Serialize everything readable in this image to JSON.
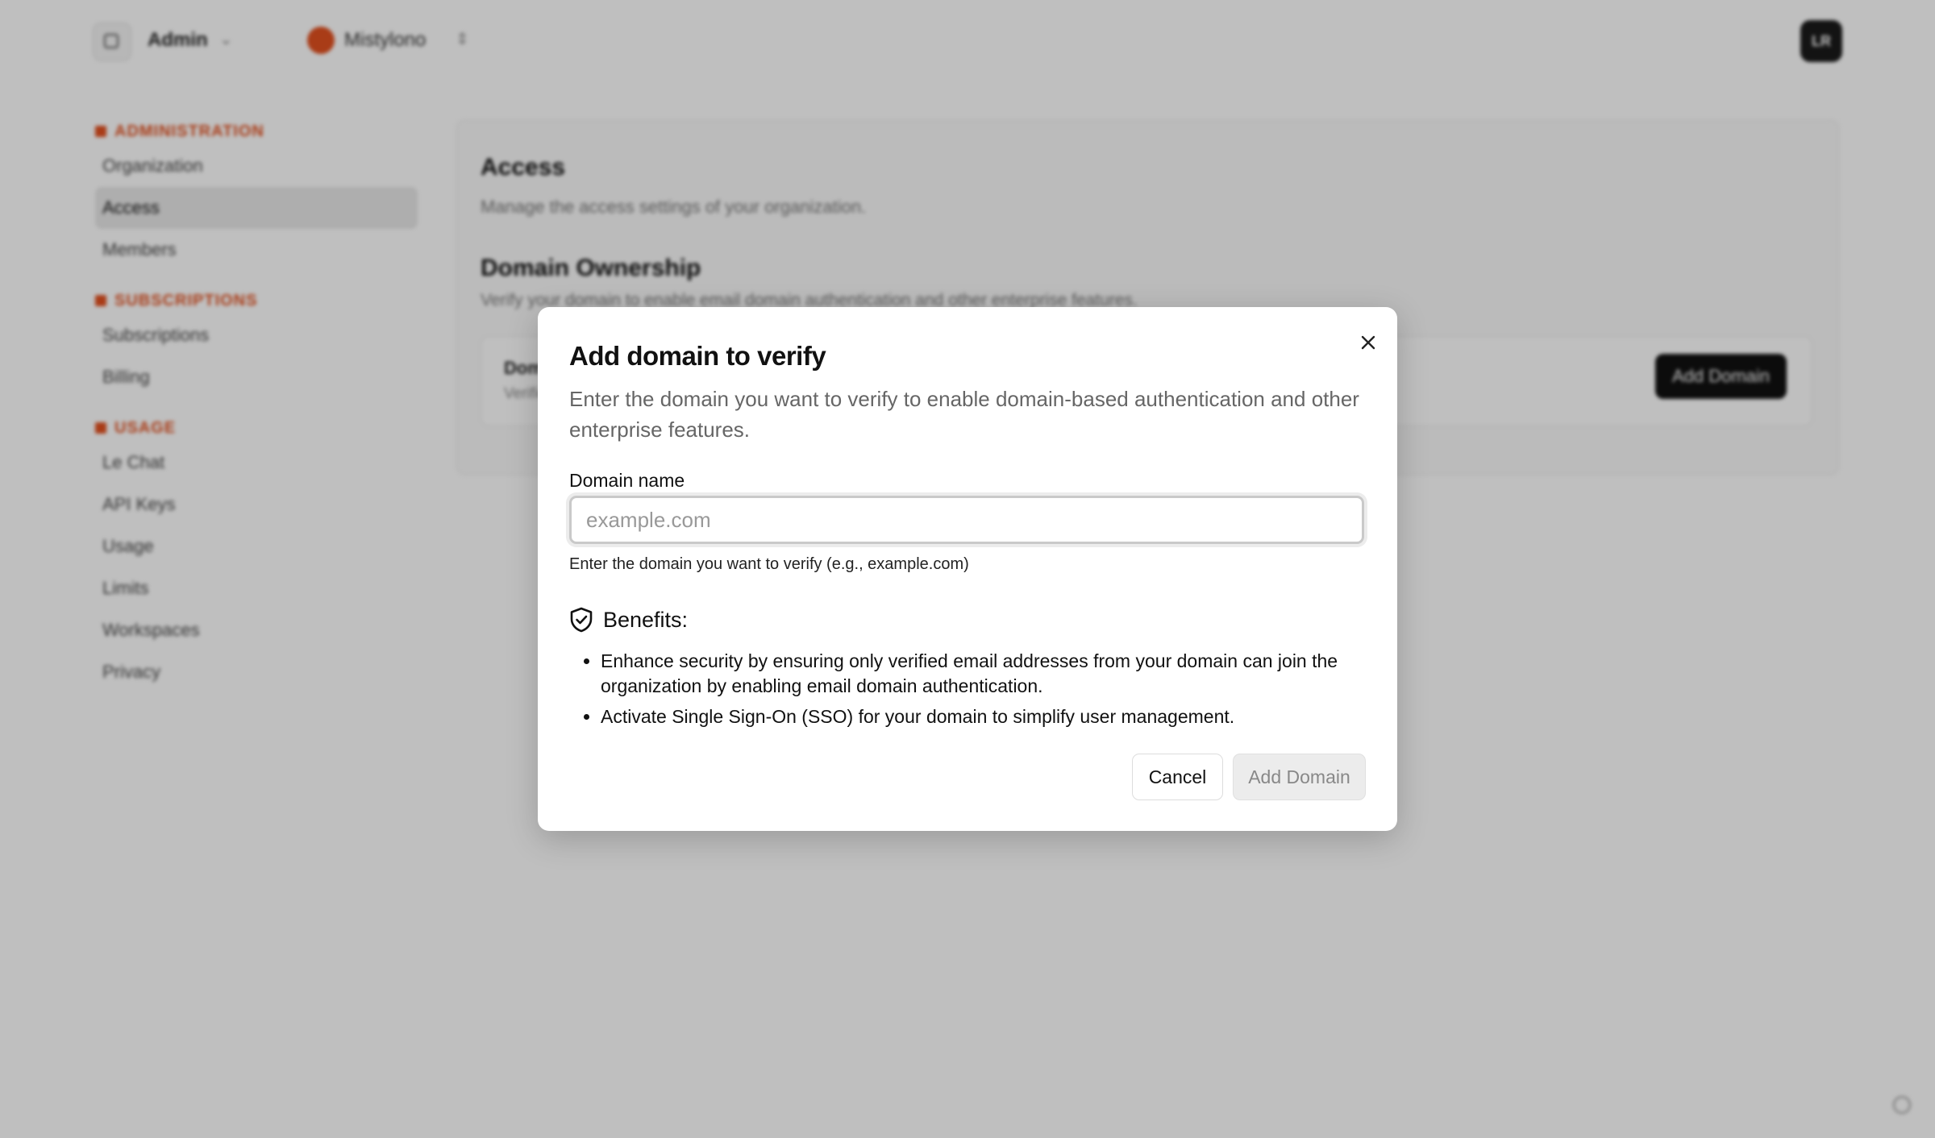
{
  "topbar": {
    "admin_label": "Admin",
    "org_name": "Mistylono",
    "user_initials": "LR"
  },
  "sidebar": {
    "sections": [
      {
        "label": "ADMINISTRATION",
        "items": [
          "Organization",
          "Access",
          "Members"
        ]
      },
      {
        "label": "SUBSCRIPTIONS",
        "items": [
          "Subscriptions",
          "Billing"
        ]
      },
      {
        "label": "USAGE",
        "items": [
          "Le Chat",
          "API Keys",
          "Usage",
          "Limits",
          "Workspaces",
          "Privacy"
        ]
      }
    ],
    "active_item": "Access"
  },
  "content": {
    "title": "Access",
    "subtitle": "Manage the access settings of your organization.",
    "domain_heading": "Domain Ownership",
    "domain_subtitle": "Verify your domain to enable email domain authentication and other enterprise features.",
    "row_title": "Domains",
    "row_subtitle": "Verified domains",
    "add_domain_label": "Add Domain"
  },
  "modal": {
    "title": "Add domain to verify",
    "description": "Enter the domain you want to verify to enable domain-based authentication and other enterprise features.",
    "field_label": "Domain name",
    "input_placeholder": "example.com",
    "input_value": "",
    "field_help": "Enter the domain you want to verify (e.g., example.com)",
    "benefits_title": "Benefits:",
    "benefits": [
      "Enhance security by ensuring only verified email addresses from your domain can join the organization by enabling email domain authentication.",
      "Activate Single Sign-On (SSO) for your domain to simplify user management."
    ],
    "cancel_label": "Cancel",
    "submit_label": "Add Domain"
  },
  "colors": {
    "accent": "#e2501f",
    "overlay": "#000000"
  },
  "icons": {
    "close": "close-icon",
    "benefits": "shield-check-icon",
    "sidebar_toggle": "sidebar-toggle-icon",
    "help": "help-icon"
  }
}
